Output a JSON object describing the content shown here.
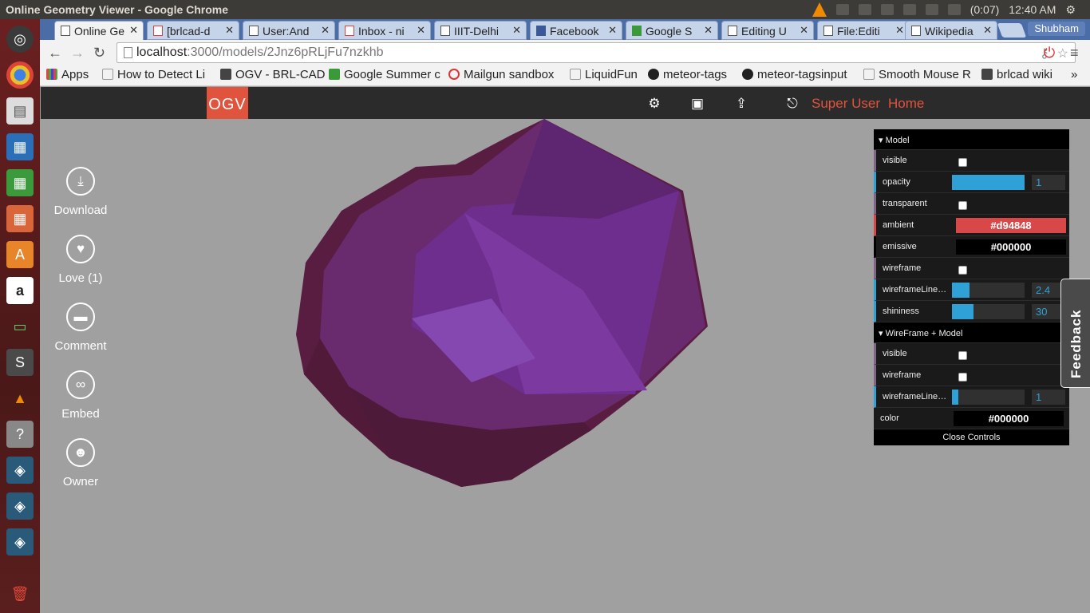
{
  "os": {
    "window_title": "Online Geometry Viewer - Google Chrome",
    "clock": "12:40 AM",
    "battery": "(0:07)"
  },
  "browser": {
    "tabs": [
      {
        "label": "Online Ge"
      },
      {
        "label": "[brlcad-d"
      },
      {
        "label": "User:And"
      },
      {
        "label": "Inbox - ni"
      },
      {
        "label": "IIIT-Delhi"
      },
      {
        "label": "Facebook"
      },
      {
        "label": "Google S"
      },
      {
        "label": "Editing U"
      },
      {
        "label": "File:Editi"
      },
      {
        "label": "Wikipedia"
      }
    ],
    "profile": "Shubham",
    "url_host": "localhost",
    "url_path": ":3000/models/2Jnz6pRLjFu7nzkhb",
    "bookmarks": [
      {
        "label": "Apps"
      },
      {
        "label": "How to Detect Li"
      },
      {
        "label": "OGV - BRL-CAD"
      },
      {
        "label": "Google Summer c"
      },
      {
        "label": "Mailgun sandbox"
      },
      {
        "label": "LiquidFun"
      },
      {
        "label": "meteor-tags"
      },
      {
        "label": "meteor-tagsinput"
      },
      {
        "label": "Smooth Mouse R"
      },
      {
        "label": "brlcad wiki"
      }
    ],
    "more": "»"
  },
  "app": {
    "logo": "OGV",
    "user": "Super User",
    "home": "Home",
    "side_actions": [
      {
        "label": "Download",
        "icon": "⤓"
      },
      {
        "label": "Love (1)",
        "icon": "♥"
      },
      {
        "label": "Comment",
        "icon": "▬"
      },
      {
        "label": "Embed",
        "icon": "∞"
      },
      {
        "label": "Owner",
        "icon": "☻"
      }
    ],
    "feedback": "Feedback"
  },
  "gui": {
    "model_folder": "Model",
    "visible_label": "visible",
    "opacity_label": "opacity",
    "opacity_value": "1",
    "opacity_level": 1,
    "transparent_label": "transparent",
    "ambient_label": "ambient",
    "ambient_value": "#d94848",
    "emissive_label": "emissive",
    "emissive_value": "#000000",
    "wireframe_label": "wireframe",
    "wireframe_linewidth_label": "wireframeLinewi...",
    "wireframe_linewidth_value": "2.4",
    "shininess_label": "shininess",
    "shininess_value": "30",
    "wm_folder": "WireFrame + Model",
    "wm_visible_label": "visible",
    "wm_wireframe_label": "wireframe",
    "wm_linewidth_label": "wireframeLinewi...",
    "wm_linewidth_value": "1",
    "color_label": "color",
    "color_value": "#000000",
    "close": "Close Controls"
  }
}
